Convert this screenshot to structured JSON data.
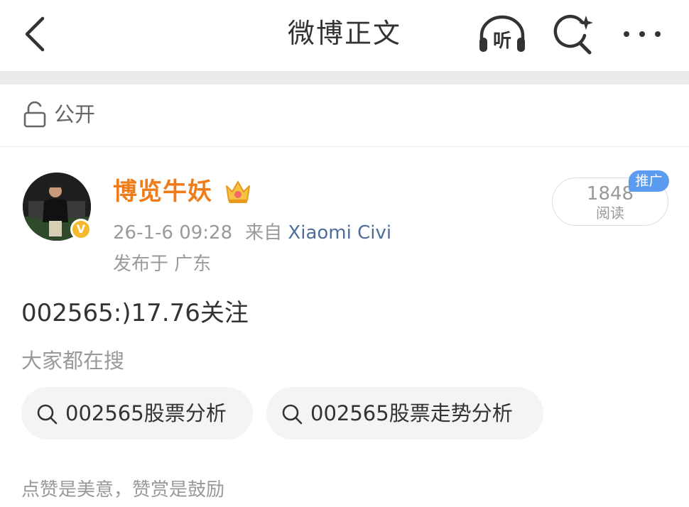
{
  "header": {
    "title": "微博正文",
    "back_icon": "chevron-left-icon",
    "listen_label": "听",
    "listen_icon": "headphones-icon",
    "search_icon": "ai-search-icon",
    "more_icon": "more-dots-icon"
  },
  "visibility": {
    "icon": "unlock-icon",
    "label": "公开"
  },
  "post": {
    "author": {
      "name": "博览牛妖",
      "verified_badge": "V",
      "crown_icon": "crown-icon"
    },
    "date": "26-1-6 09:28",
    "source_prefix": "来自",
    "source_device": "Xiaomi Civi",
    "location": "发布于 广东",
    "read_count": "1848",
    "read_label": "阅读",
    "promo_label": "推广",
    "text": "002565:)17.76关注"
  },
  "hot_search": {
    "title": "大家都在搜",
    "items": [
      {
        "label": "002565股票分析",
        "icon": "search-icon"
      },
      {
        "label": "002565股票走势分析",
        "icon": "search-icon"
      }
    ]
  },
  "footer": {
    "text": "点赞是美意，赞赏是鼓励"
  },
  "colors": {
    "author": "#f07c19",
    "device_link": "#4f6e9a",
    "promo": "#5b9bf0",
    "verified": "#f5b92d"
  }
}
